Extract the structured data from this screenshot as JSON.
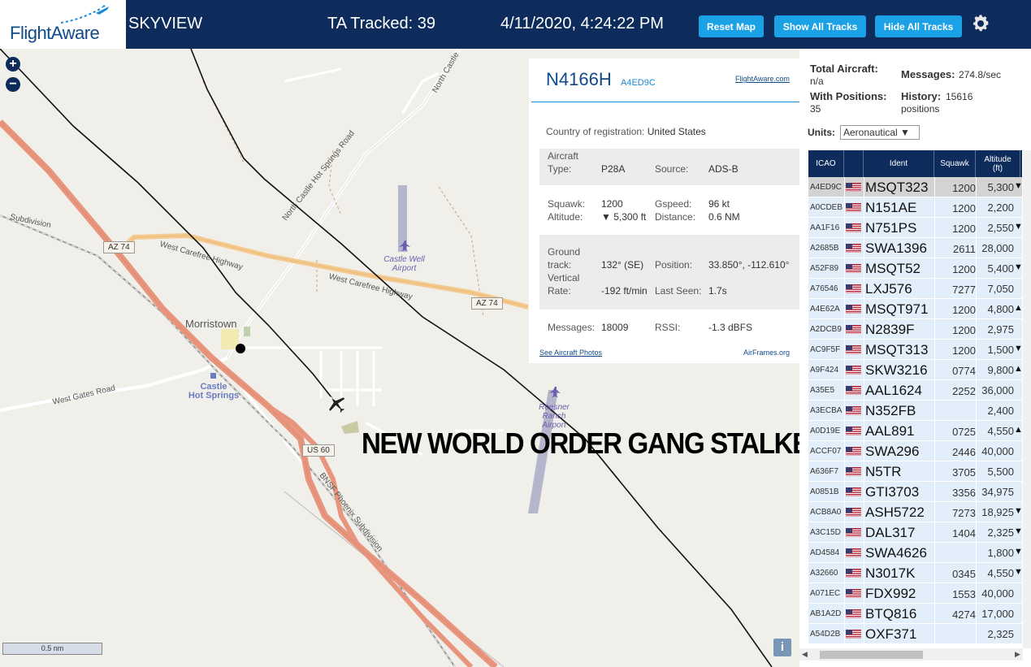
{
  "header": {
    "logo": "FlightAware",
    "app_name": "SKYVIEW",
    "ta_tracked": "TA Tracked: 39",
    "clock": "4/11/2020, 4:24:22 PM",
    "buttons": {
      "reset": "Reset Map",
      "show": "Show All Tracks",
      "hide": "Hide All Tracks"
    }
  },
  "map": {
    "zoom_in": "+",
    "zoom_out": "−",
    "scale": "0.5 nm",
    "info": "i",
    "overlay_text": "NEW WORLD ORDER GANG STALKER",
    "labels": {
      "north_castle": "North Castle Hot Springs Road",
      "north_castle_top": "North Castle",
      "carefree1": "West Carefree Highway",
      "carefree2": "West Carefree Highway",
      "gates": "West Gates Road",
      "subdivision": "Subdivision",
      "bnsf": "BNSF Phoenix Subdivision",
      "az74a": "AZ 74",
      "az74b": "AZ 74",
      "us60": "US 60",
      "morristown": "Morristown",
      "castle_hot": "Castle\nHot Springs",
      "castle_well": "Castle Well\nAirport",
      "roesner": "Roesner\nRanch\nAirport"
    }
  },
  "detail": {
    "ident": "N4166H",
    "hex": "A4ED9C",
    "fa_link": "FlightAware.com",
    "country_label": "Country of registration:",
    "country_value": "United States",
    "aircraft_type_label1": "Aircraft",
    "aircraft_type_label2": "Type:",
    "aircraft_type": "P28A",
    "source_label": "Source:",
    "source": "ADS-B",
    "squawk_label": "Squawk:",
    "squawk": "1200",
    "gspeed_label": "Gspeed:",
    "gspeed": "96 kt",
    "altitude_label": "Altitude:",
    "altitude": "▼ 5,300 ft",
    "distance_label": "Distance:",
    "distance": "0.6 NM",
    "ground_label1": "Ground",
    "ground_label2": "track:",
    "ground_track": "132° (SE)",
    "position_label": "Position:",
    "position": "33.850°, -112.610°",
    "vertical_label1": "Vertical",
    "vertical_label2": "Rate:",
    "vertical_rate": "-192 ft/min",
    "last_seen_label": "Last Seen:",
    "last_seen": "1.7s",
    "messages_label": "Messages:",
    "messages": "18009",
    "rssi_label": "RSSI:",
    "rssi": "-1.3 dBFS",
    "photos_link": "See Aircraft Photos",
    "airframes_link": "AirFrames.org"
  },
  "sidebar": {
    "total_label": "Total Aircraft:",
    "total_value": "n/a",
    "messages_label": "Messages:",
    "messages_value": "274.8/sec",
    "with_pos_label": "With Positions:",
    "with_pos_value": "35",
    "history_label": "History:",
    "history_value": "15616",
    "history_unit": "positions",
    "units_label": "Units:",
    "units_value": "Aeronautical ▼",
    "columns": {
      "icao": "ICAO",
      "ident": "Ident",
      "squawk": "Squawk",
      "altitude": "Altitude\n(ft)"
    },
    "rows": [
      {
        "icao": "A4ED9C",
        "ident": "MSQT323",
        "squawk": "1200",
        "alt": "5,300",
        "arrow": "▼",
        "selected": true
      },
      {
        "icao": "A0CDEB",
        "ident": "N151AE",
        "squawk": "1200",
        "alt": "2,200",
        "arrow": ""
      },
      {
        "icao": "AA1F16",
        "ident": "N751PS",
        "squawk": "1200",
        "alt": "2,550",
        "arrow": "▼"
      },
      {
        "icao": "A2685B",
        "ident": "SWA1396",
        "squawk": "2611",
        "alt": "28,000",
        "arrow": ""
      },
      {
        "icao": "A52F89",
        "ident": "MSQT52",
        "squawk": "1200",
        "alt": "5,400",
        "arrow": "▼"
      },
      {
        "icao": "A76546",
        "ident": "LXJ576",
        "squawk": "7277",
        "alt": "7,050",
        "arrow": ""
      },
      {
        "icao": "A4E62A",
        "ident": "MSQT971",
        "squawk": "1200",
        "alt": "4,800",
        "arrow": "▲"
      },
      {
        "icao": "A2DCB9",
        "ident": "N2839F",
        "squawk": "1200",
        "alt": "2,975",
        "arrow": ""
      },
      {
        "icao": "AC9F5F",
        "ident": "MSQT313",
        "squawk": "1200",
        "alt": "1,500",
        "arrow": "▼"
      },
      {
        "icao": "A9F424",
        "ident": "SKW3216",
        "squawk": "0774",
        "alt": "9,800",
        "arrow": "▲"
      },
      {
        "icao": "A35E5",
        "ident": "AAL1624",
        "squawk": "2252",
        "alt": "36,000",
        "arrow": ""
      },
      {
        "icao": "A3ECBA",
        "ident": "N352FB",
        "squawk": "",
        "alt": "2,400",
        "arrow": ""
      },
      {
        "icao": "A0D19E",
        "ident": "AAL891",
        "squawk": "0725",
        "alt": "4,550",
        "arrow": "▲"
      },
      {
        "icao": "ACCF07",
        "ident": "SWA296",
        "squawk": "2446",
        "alt": "40,000",
        "arrow": ""
      },
      {
        "icao": "A636F7",
        "ident": "N5TR",
        "squawk": "3705",
        "alt": "5,500",
        "arrow": ""
      },
      {
        "icao": "A0851B",
        "ident": "GTI3703",
        "squawk": "3356",
        "alt": "34,975",
        "arrow": ""
      },
      {
        "icao": "ACB8A0",
        "ident": "ASH5722",
        "squawk": "7273",
        "alt": "18,925",
        "arrow": "▼"
      },
      {
        "icao": "A3C15D",
        "ident": "DAL317",
        "squawk": "1404",
        "alt": "2,325",
        "arrow": "▼"
      },
      {
        "icao": "AD4584",
        "ident": "SWA4626",
        "squawk": "",
        "alt": "1,800",
        "arrow": "▼"
      },
      {
        "icao": "A32660",
        "ident": "N3017K",
        "squawk": "0345",
        "alt": "4,550",
        "arrow": "▼"
      },
      {
        "icao": "A071EC",
        "ident": "FDX992",
        "squawk": "1553",
        "alt": "40,000",
        "arrow": ""
      },
      {
        "icao": "AB1A2D",
        "ident": "BTQ816",
        "squawk": "4274",
        "alt": "17,000",
        "arrow": ""
      },
      {
        "icao": "A54D2B",
        "ident": "OXF371",
        "squawk": "",
        "alt": "2,325",
        "arrow": ""
      }
    ]
  },
  "colors": {
    "header": "#0d2c5b",
    "button": "#1aa1e6",
    "row": "#e2effa",
    "map": "#f1efe9",
    "highway": "#e8957e"
  }
}
